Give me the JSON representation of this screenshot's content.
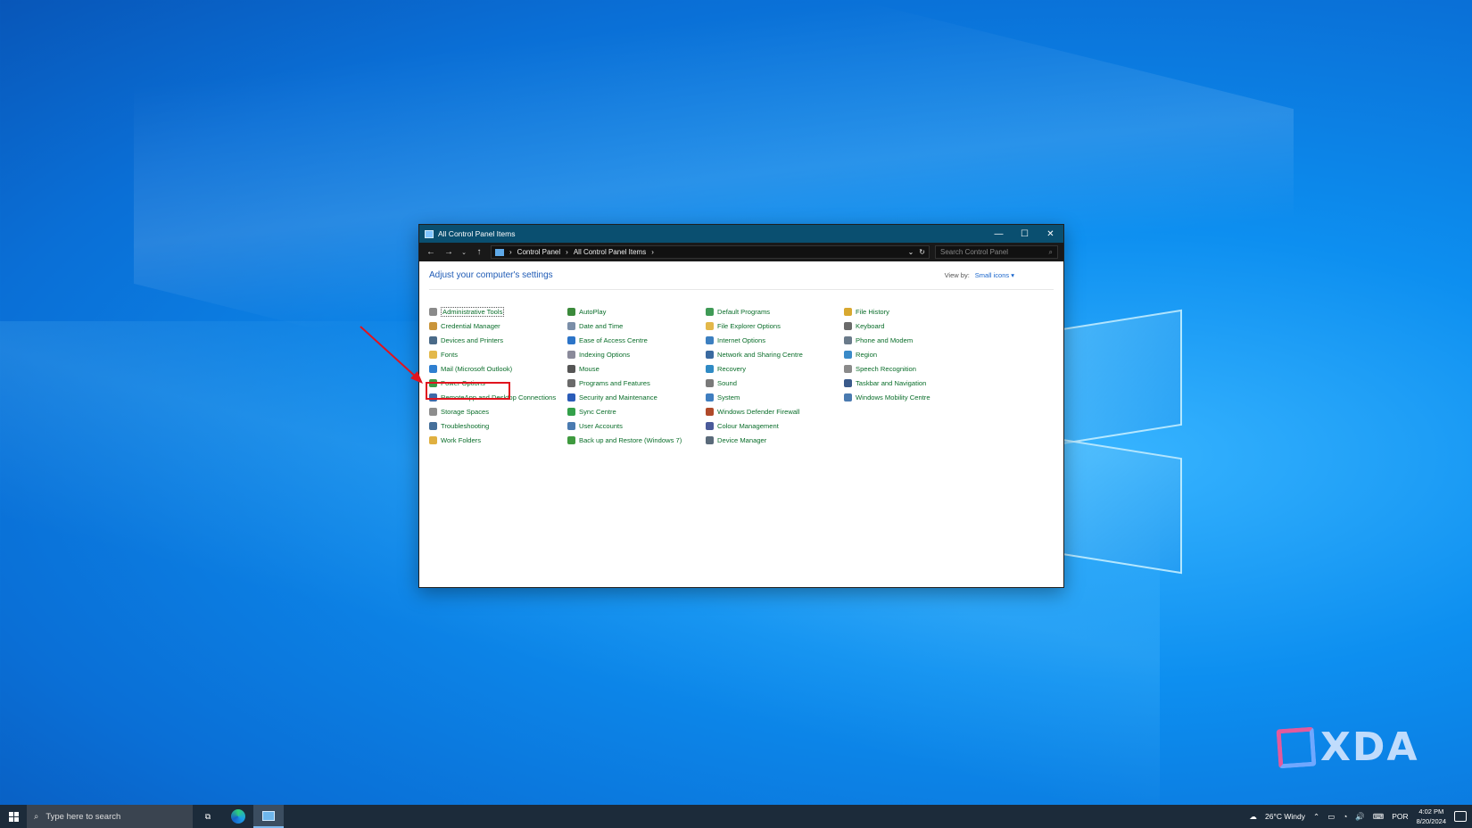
{
  "window": {
    "title": "All Control Panel Items",
    "minimize": "—",
    "maximize": "☐",
    "close": "✕",
    "breadcrumb": [
      "Control Panel",
      "All Control Panel Items"
    ],
    "search_placeholder": "Search Control Panel",
    "heading": "Adjust your computer's settings",
    "view_by_label": "View by:",
    "view_by_value": "Small icons"
  },
  "items": [
    {
      "label": "Administrative Tools",
      "color": "#8a8a8a"
    },
    {
      "label": "Credential Manager",
      "color": "#c9943a"
    },
    {
      "label": "Devices and Printers",
      "color": "#4a6a88"
    },
    {
      "label": "Fonts",
      "color": "#e3b84a"
    },
    {
      "label": "Mail (Microsoft Outlook)",
      "color": "#2f7fd0"
    },
    {
      "label": "Power Options",
      "color": "#3c9a48"
    },
    {
      "label": "RemoteApp and Desktop Connections",
      "color": "#3e6aa8"
    },
    {
      "label": "Storage Spaces",
      "color": "#8d8d8d"
    },
    {
      "label": "Troubleshooting",
      "color": "#456f9a"
    },
    {
      "label": "Work Folders",
      "color": "#e0b040"
    },
    {
      "label": "AutoPlay",
      "color": "#3b8a3b"
    },
    {
      "label": "Date and Time",
      "color": "#7a8ea8"
    },
    {
      "label": "Ease of Access Centre",
      "color": "#2c74c8"
    },
    {
      "label": "Indexing Options",
      "color": "#8a8a9a"
    },
    {
      "label": "Mouse",
      "color": "#555555"
    },
    {
      "label": "Programs and Features",
      "color": "#6a6a6a"
    },
    {
      "label": "Security and Maintenance",
      "color": "#2a5cb8"
    },
    {
      "label": "Sync Centre",
      "color": "#33a04a"
    },
    {
      "label": "User Accounts",
      "color": "#4a7ab0"
    },
    {
      "label": "Back up and Restore (Windows 7)",
      "color": "#3f9a3f"
    },
    {
      "label": "Default Programs",
      "color": "#3f9a56"
    },
    {
      "label": "File Explorer Options",
      "color": "#e3b84a"
    },
    {
      "label": "Internet Options",
      "color": "#3c7fc0"
    },
    {
      "label": "Network and Sharing Centre",
      "color": "#3a6aa0"
    },
    {
      "label": "Recovery",
      "color": "#2f8ac4"
    },
    {
      "label": "Sound",
      "color": "#7a7a7a"
    },
    {
      "label": "System",
      "color": "#3f7ec0"
    },
    {
      "label": "Windows Defender Firewall",
      "color": "#b04a2a"
    },
    {
      "label": "Colour Management",
      "color": "#4a5a9a"
    },
    {
      "label": "Device Manager",
      "color": "#5a6a7a"
    },
    {
      "label": "File History",
      "color": "#d8a830"
    },
    {
      "label": "Keyboard",
      "color": "#6a6a6a"
    },
    {
      "label": "Phone and Modem",
      "color": "#6a7a8a"
    },
    {
      "label": "Region",
      "color": "#3a8ac8"
    },
    {
      "label": "Speech Recognition",
      "color": "#8a8a8a"
    },
    {
      "label": "Taskbar and Navigation",
      "color": "#3a5a8a"
    },
    {
      "label": "Windows Mobility Centre",
      "color": "#4a7ab0"
    }
  ],
  "taskbar": {
    "search_placeholder": "Type here to search",
    "weather": "26°C  Windy",
    "language": "POR",
    "time": "4:02 PM",
    "date": "8/20/2024"
  },
  "watermark": "XDA"
}
